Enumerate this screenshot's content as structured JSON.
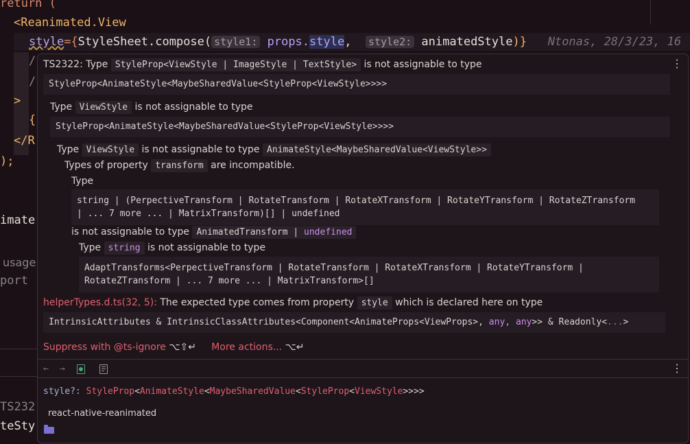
{
  "editor": {
    "line_return": "return (",
    "line_open_tag": "<Reanimated.View",
    "style_attr": "style",
    "style_eq": "={",
    "fn_call": "StyleSheet.compose(",
    "hint1": "style1:",
    "arg1_obj": "props.",
    "arg1_prop": "style",
    "arg_comma": ",",
    "hint2": "style2:",
    "arg2": "animatedStyle",
    "close": ")}",
    "blame": "Ntonas, 28/3/23, 16",
    "frag_slash1": "/",
    "frag_slash2": "/",
    "frag_gt": ">",
    "frag_brace": "{",
    "frag_closetag": "</R",
    "frag_paren": ");",
    "frag_imate": "imate",
    "frag_usage": "usage",
    "frag_port": "port",
    "frag_ts": "TS232",
    "frag_testy": "teSty"
  },
  "popup": {
    "error_code": "TS2322:",
    "type_word": "Type",
    "type_union": "StyleProp<ViewStyle | ImageStyle | TextStyle>",
    "not_assignable": "is not assignable to type",
    "target_type": "StyleProp<AnimateStyle<MaybeSharedValue<StyleProp<ViewStyle>>>>",
    "l2_type": "Type",
    "l2_viewstyle": "ViewStyle",
    "l2_not": "is not assignable to type",
    "l2_target": "StyleProp<AnimateStyle<MaybeSharedValue<StyleProp<ViewStyle>>>>",
    "l3_type": "Type",
    "l3_viewstyle": "ViewStyle",
    "l3_not": "is not assignable to type",
    "l3_target": "AnimateStyle<MaybeSharedValue<ViewStyle>>",
    "l4_pre": "Types of property",
    "l4_prop": "transform",
    "l4_post": "are incompatible.",
    "l5_type": "Type",
    "l5_code1": "string | (PerpectiveTransform | RotateTransform | RotateXTransform | RotateYTransform | RotateZTransform",
    "l5_code2": "| ... 7 more ... | MatrixTransform)[] | undefined",
    "l6_pre": "is not assignable to type",
    "l6_type": "AnimatedTransform |",
    "l6_undef": "undefined",
    "l7_type": "Type",
    "l7_string": "string",
    "l7_not": "is not assignable to type",
    "l7_code1": "AdaptTransforms<PerpectiveTransform | RotateTransform | RotateXTransform | RotateYTransform |",
    "l7_code2": "RotateZTransform | ... 7 more ... | MatrixTransform>[]",
    "helper_link": "helperTypes.d.ts(32, 5):",
    "helper_text": "The expected type comes from property",
    "helper_prop": "style",
    "helper_text2": "which is declared here on type",
    "intrinsic_pre": "IntrinsicAttributes & IntrinsicClassAttributes<Component<AnimateProps<ViewProps>,",
    "intrinsic_any1": "any,",
    "intrinsic_any2": "any",
    "intrinsic_post": ">> & Readonly<",
    "intrinsic_dots": "...",
    "intrinsic_end": ">",
    "suppress_label": "Suppress with @ts-ignore",
    "suppress_shortcut": "⌥⇧↵",
    "more_label": "More actions...",
    "more_shortcut": "⌥↵",
    "menu_dots": "⋮",
    "doc_sig_name": "style?:",
    "doc_sig_1": "StyleProp",
    "doc_sig_2": "AnimateStyle",
    "doc_sig_3": "MaybeSharedValue",
    "doc_sig_4": "StyleProp",
    "doc_sig_5": "ViewStyle",
    "doc_sig_end": ">>>>",
    "lt": "<",
    "module": "react-native-reanimated",
    "back_icon": "←",
    "fwd_icon": "→",
    "toolbar_dots": "⋮"
  },
  "colors": {
    "error_red": "#e0606e",
    "keyword_purple": "#c792ea",
    "background": "#1a1015"
  }
}
